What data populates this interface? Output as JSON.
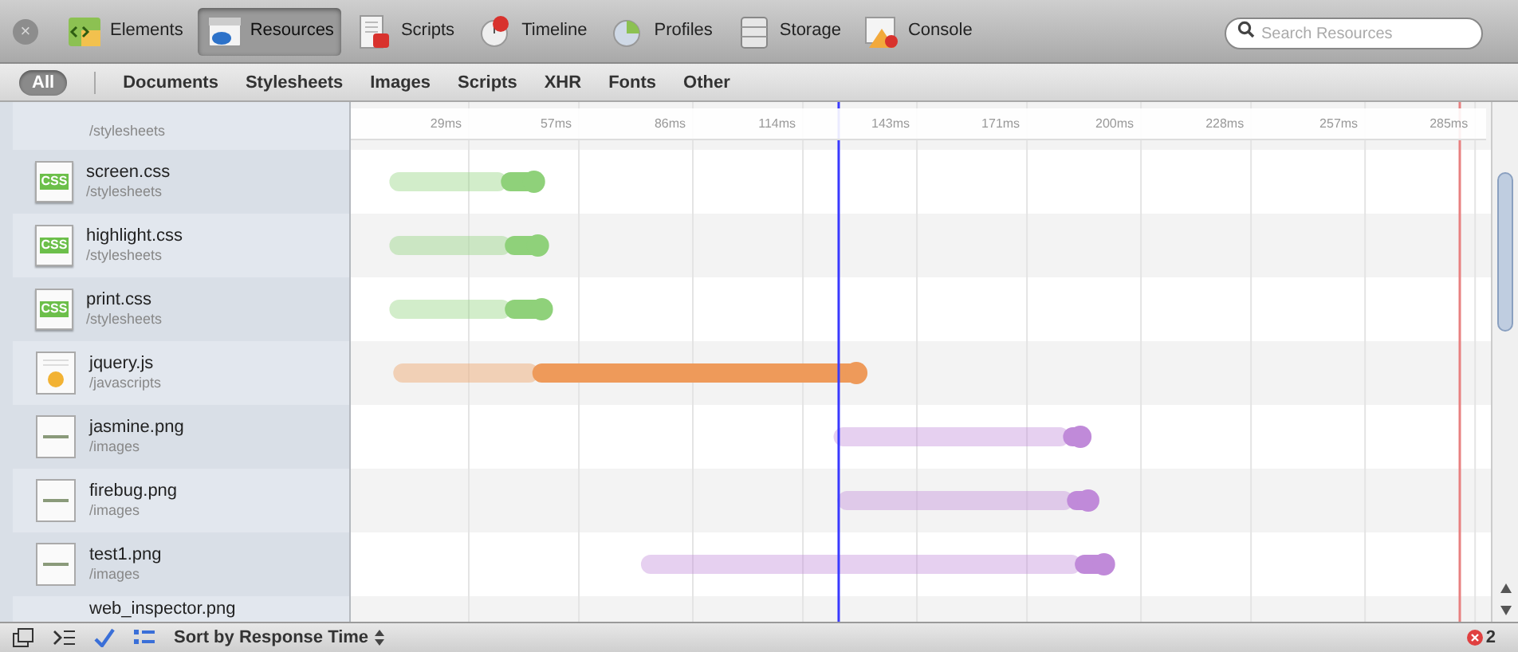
{
  "toolbar": {
    "close": "×",
    "tabs": [
      {
        "label": "Elements",
        "kind": "elements",
        "selected": false
      },
      {
        "label": "Resources",
        "kind": "resources",
        "selected": true
      },
      {
        "label": "Scripts",
        "kind": "scripts",
        "selected": false
      },
      {
        "label": "Timeline",
        "kind": "timeline",
        "selected": false
      },
      {
        "label": "Profiles",
        "kind": "profiles",
        "selected": false
      },
      {
        "label": "Storage",
        "kind": "storage",
        "selected": false
      },
      {
        "label": "Console",
        "kind": "console",
        "selected": false
      }
    ],
    "search": {
      "placeholder": "Search Resources"
    }
  },
  "filters": [
    {
      "label": "All",
      "selected": true
    },
    {
      "label": "Documents",
      "selected": false
    },
    {
      "label": "Stylesheets",
      "selected": false
    },
    {
      "label": "Images",
      "selected": false
    },
    {
      "label": "Scripts",
      "selected": false
    },
    {
      "label": "XHR",
      "selected": false
    },
    {
      "label": "Fonts",
      "selected": false
    },
    {
      "label": "Other",
      "selected": false
    }
  ],
  "resources": [
    {
      "path": "/stylesheets",
      "kind": "stylesheet"
    },
    {
      "name": "screen.css",
      "path": "/stylesheets",
      "kind": "stylesheet",
      "icon_label": "CSS",
      "color": "#8fd17a"
    },
    {
      "name": "highlight.css",
      "path": "/stylesheets",
      "kind": "stylesheet",
      "icon_label": "CSS",
      "color": "#8fd17a"
    },
    {
      "name": "print.css",
      "path": "/stylesheets",
      "kind": "stylesheet",
      "icon_label": "CSS",
      "color": "#8fd17a"
    },
    {
      "name": "jquery.js",
      "path": "/javascripts",
      "kind": "script",
      "color": "#ee9a5a"
    },
    {
      "name": "jasmine.png",
      "path": "/images",
      "kind": "image",
      "color": "#c08ad9"
    },
    {
      "name": "firebug.png",
      "path": "/images",
      "kind": "image",
      "color": "#c08ad9"
    },
    {
      "name": "test1.png",
      "path": "/images",
      "kind": "image",
      "color": "#c08ad9"
    },
    {
      "name": "web_inspector.png",
      "kind": "image"
    }
  ],
  "timeline": {
    "ticks": [
      "29ms",
      "57ms",
      "86ms",
      "114ms",
      "143ms",
      "171ms",
      "200ms",
      "228ms",
      "257ms",
      "285ms"
    ]
  },
  "status_bar": {
    "sort": "Sort by Response Time",
    "errors": "2"
  }
}
